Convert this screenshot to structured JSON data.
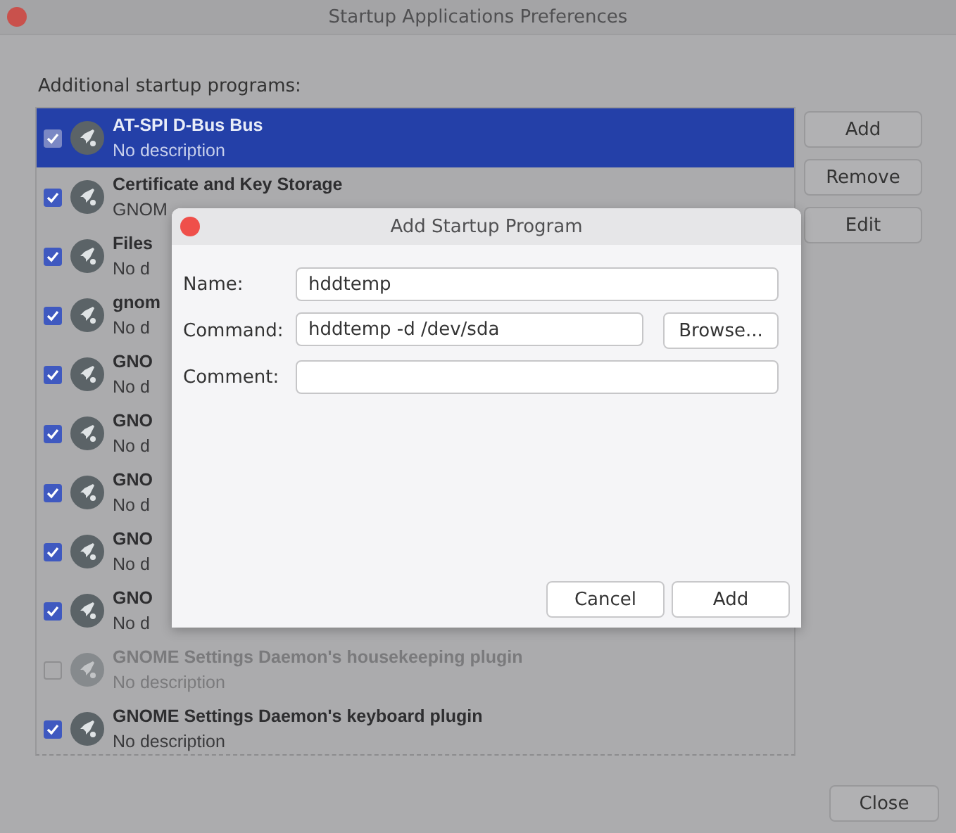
{
  "window": {
    "title": "Startup Applications Preferences"
  },
  "list_label": "Additional startup programs:",
  "programs": [
    {
      "name": "AT-SPI D-Bus Bus",
      "description": "No description",
      "checked": true,
      "selected": true,
      "disabled": false
    },
    {
      "name": "Certificate and Key Storage",
      "description": "GNOM",
      "checked": true,
      "selected": false,
      "disabled": false
    },
    {
      "name": "Files",
      "description": "No d",
      "checked": true,
      "selected": false,
      "disabled": false
    },
    {
      "name": "gnom",
      "description": "No d",
      "checked": true,
      "selected": false,
      "disabled": false
    },
    {
      "name": "GNO",
      "description": "No d",
      "checked": true,
      "selected": false,
      "disabled": false
    },
    {
      "name": "GNO",
      "description": "No d",
      "checked": true,
      "selected": false,
      "disabled": false
    },
    {
      "name": "GNO",
      "description": "No d",
      "checked": true,
      "selected": false,
      "disabled": false
    },
    {
      "name": "GNO",
      "description": "No d",
      "checked": true,
      "selected": false,
      "disabled": false
    },
    {
      "name": "GNO",
      "description": "No d",
      "checked": true,
      "selected": false,
      "disabled": false
    },
    {
      "name": "GNOME Settings Daemon's housekeeping plugin",
      "description": "No description",
      "checked": false,
      "selected": false,
      "disabled": true
    },
    {
      "name": "GNOME Settings Daemon's keyboard plugin",
      "description": "No description",
      "checked": true,
      "selected": false,
      "disabled": false
    }
  ],
  "side_buttons": [
    "Add",
    "Remove",
    "Edit"
  ],
  "close_button": "Close",
  "dialog": {
    "title": "Add Startup Program",
    "fields": [
      {
        "label": "Name:",
        "value": "hddtemp",
        "kind": "text"
      },
      {
        "label": "Command:",
        "value": "hddtemp -d /dev/sda",
        "kind": "browse",
        "button": "Browse..."
      },
      {
        "label": "Comment:",
        "kind": "text"
      }
    ],
    "buttons": [
      "Cancel",
      "Add"
    ]
  }
}
